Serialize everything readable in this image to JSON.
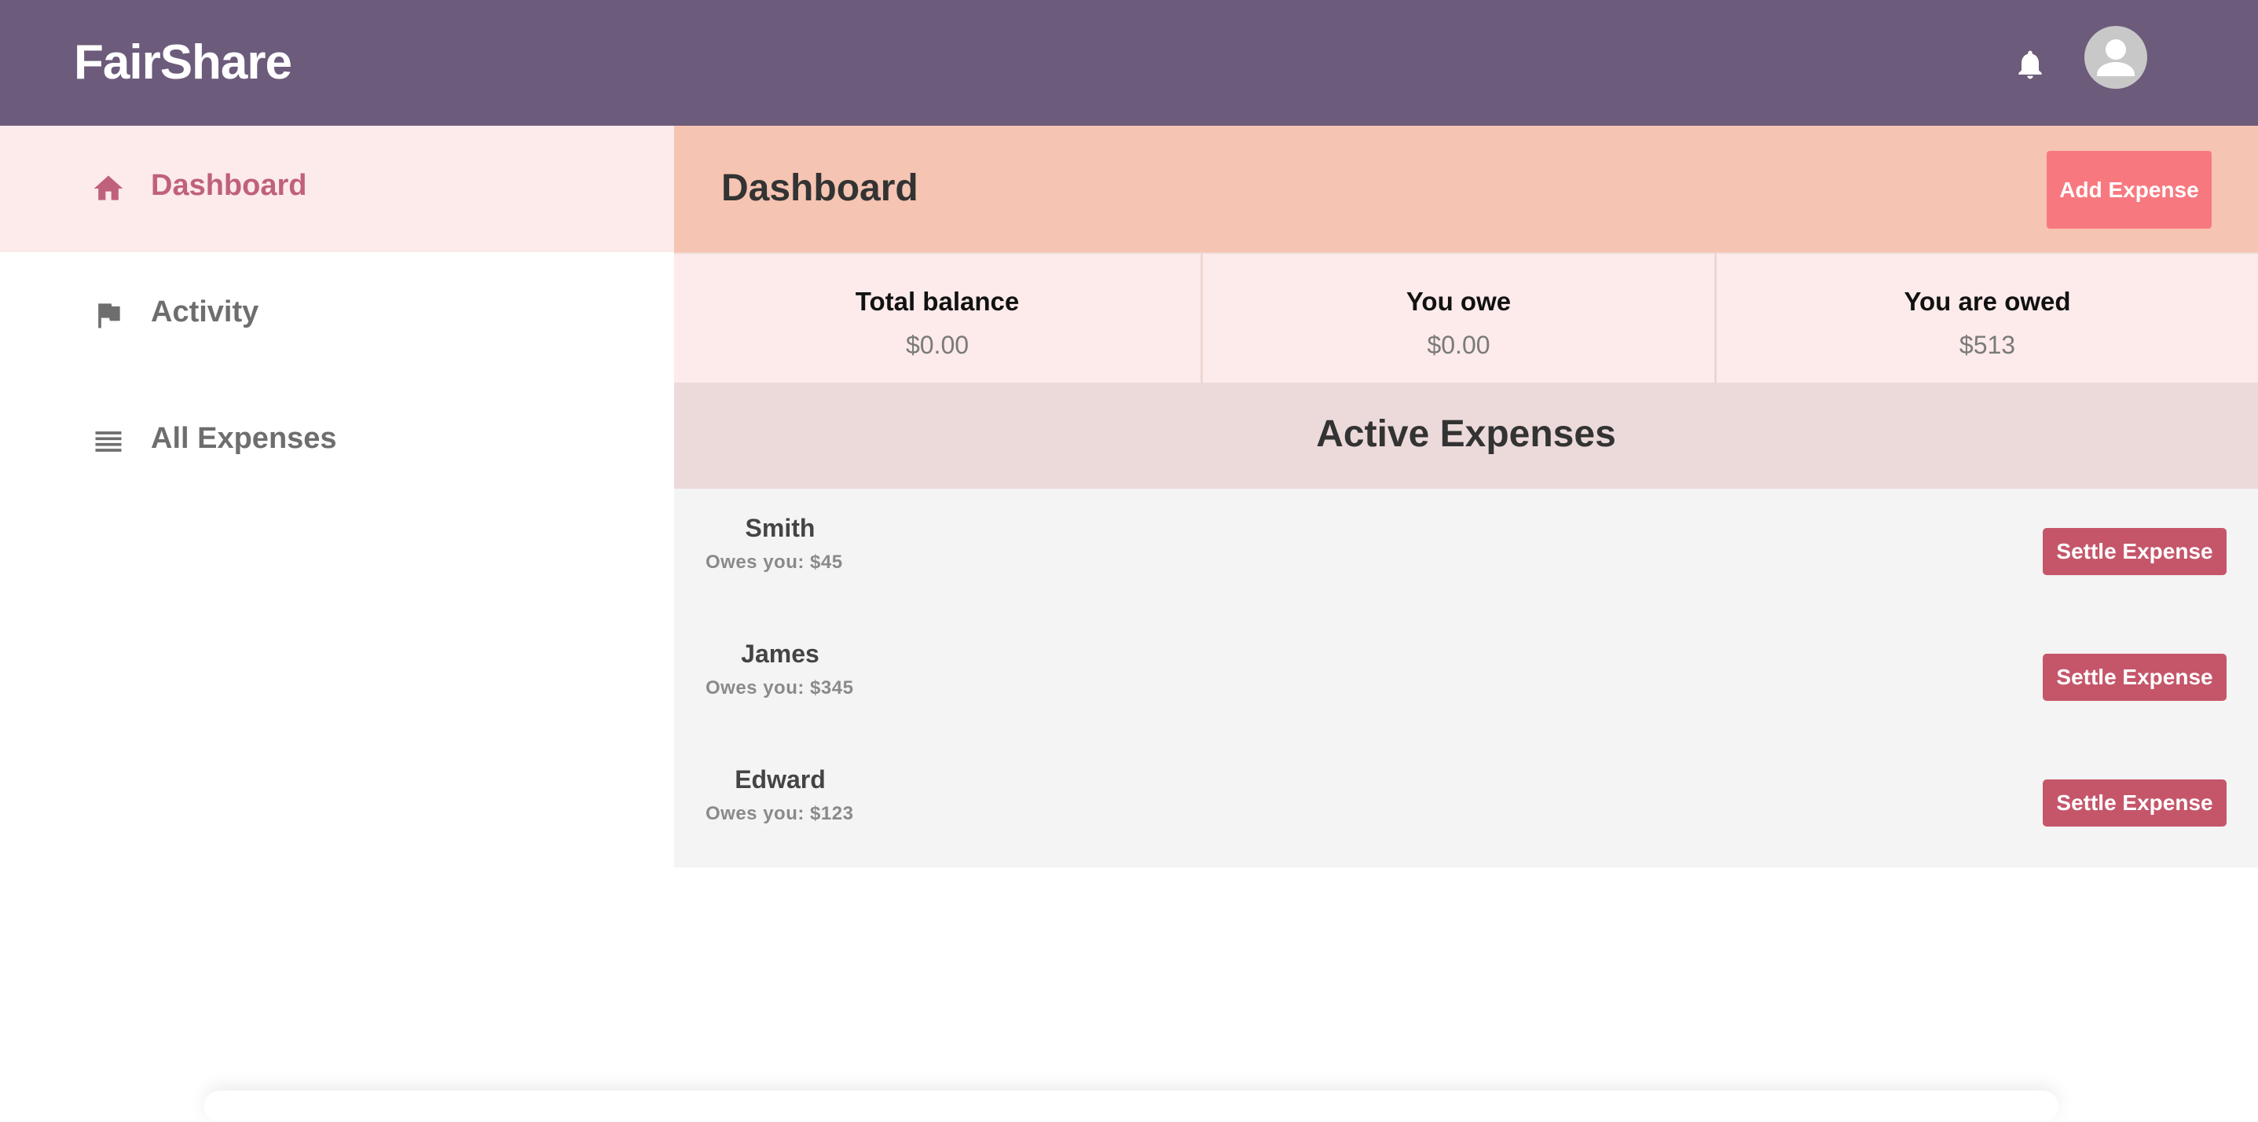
{
  "app": {
    "brand": "FairShare",
    "icons": {
      "notifications": "bell-icon",
      "profile": "user-avatar-icon"
    }
  },
  "sidebar": {
    "items": [
      {
        "label": "Dashboard",
        "icon": "home-icon",
        "active": true
      },
      {
        "label": "Activity",
        "icon": "flag-icon",
        "active": false
      },
      {
        "label": "All Expenses",
        "icon": "list-icon",
        "active": false
      }
    ]
  },
  "dashboard": {
    "title": "Dashboard",
    "add_button": "Add Expense",
    "summary": [
      {
        "label": "Total balance",
        "value": "$0.00"
      },
      {
        "label": "You owe",
        "value": "$0.00"
      },
      {
        "label": "You are owed",
        "value": "$513"
      }
    ]
  },
  "active_expenses": {
    "title": "Active Expenses",
    "items": [
      {
        "name": "Smith",
        "detail": "Owes you: $45",
        "action": "Settle Expense"
      },
      {
        "name": "James",
        "detail": "Owes you: $345",
        "action": "Settle Expense"
      },
      {
        "name": "Edward",
        "detail": "Owes you: $123",
        "action": "Settle Expense"
      }
    ]
  },
  "colors": {
    "topbar": "#6c5b7b",
    "header": "#f6c4b2",
    "accent": "#c0617a",
    "add_button": "#f7797f",
    "settle_button": "#c5566a"
  }
}
